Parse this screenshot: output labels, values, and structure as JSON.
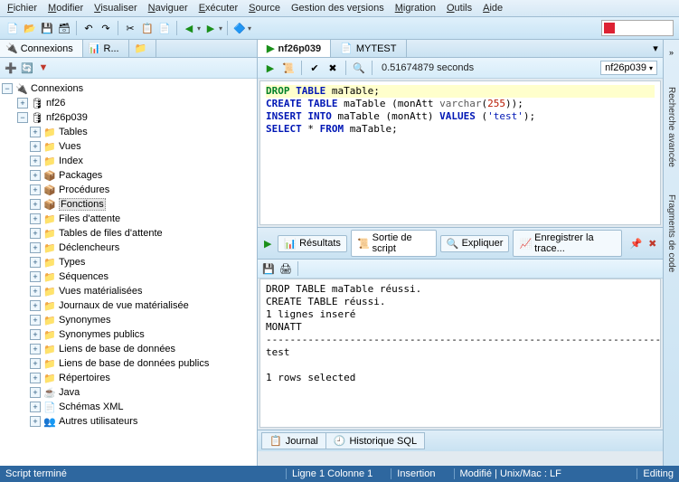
{
  "menu": [
    "Fichier",
    "Modifier",
    "Visualiser",
    "Naviguer",
    "Exécuter",
    "Source",
    "Gestion des versions",
    "Migration",
    "Outils",
    "Aide"
  ],
  "left": {
    "tabs": {
      "connections": "Connexions",
      "reports": "R..."
    },
    "root": "Connexions",
    "db1": "nf26",
    "db2": "nf26p039",
    "nodes": [
      "Tables",
      "Vues",
      "Index",
      "Packages",
      "Procédures",
      "Fonctions",
      "Files d'attente",
      "Tables de files d'attente",
      "Déclencheurs",
      "Types",
      "Séquences",
      "Vues matérialisées",
      "Journaux de vue matérialisée",
      "Synonymes",
      "Synonymes publics",
      "Liens de base de données",
      "Liens de base de données publics",
      "Répertoires",
      "Java",
      "Schémas XML",
      "Autres utilisateurs"
    ],
    "selected": "Fonctions"
  },
  "right": {
    "tab1": "nf26p039",
    "tab2": "MYTEST",
    "status_time": "0.51674879 seconds",
    "conn": "nf26p039",
    "sql_l1_kw1": "DROP",
    "sql_l1_kw2": "TABLE",
    "sql_l1_t": " maTable;",
    "sql_l2_kw1": "CREATE",
    "sql_l2_kw2": "TABLE",
    "sql_l2_t1": " maTable (monAtt ",
    "sql_l2_t2": "varchar",
    "sql_l2_t3": "(",
    "sql_l2_n": "255",
    "sql_l2_t4": "));",
    "sql_l3_kw1": "INSERT",
    "sql_l3_kw2": "INTO",
    "sql_l3_t1": " maTable (monAtt) ",
    "sql_l3_kw3": "VALUES",
    "sql_l3_t2": " (",
    "sql_l3_s": "'test'",
    "sql_l3_t3": ");",
    "sql_l4_kw1": "SELECT",
    "sql_l4_t1": " * ",
    "sql_l4_kw2": "FROM",
    "sql_l4_t2": " maTable;",
    "mid": {
      "results": "Résultats",
      "script": "Sortie de script",
      "explain": "Expliquer",
      "trace": "Enregistrer la trace..."
    },
    "output": "DROP TABLE maTable réussi.\nCREATE TABLE réussi.\n1 lignes inseré\nMONATT\n-----------------------------------------------------------------------------\ntest\n\n1 rows selected",
    "btabs": {
      "journal": "Journal",
      "hist": "Historique SQL"
    },
    "side": {
      "search": "Recherche avancée",
      "frag": "Fragments de code"
    }
  },
  "status": {
    "left": "Script terminé",
    "pos": "Ligne 1 Colonne 1",
    "ins": "Insertion",
    "mod": "Modifié",
    "eol": "Unix/Mac : LF",
    "mode": "Editing"
  }
}
